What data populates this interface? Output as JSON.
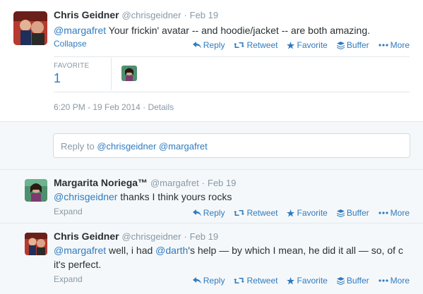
{
  "main_tweet": {
    "name": "Chris Geidner",
    "handle": "@chrisgeidner",
    "sep": "·",
    "date": "Feb 19",
    "mention": "@margafret",
    "text": " Your frickin' avatar -- and hoodie/jacket -- are both amazing.",
    "collapse": "Collapse",
    "stats_label": "FAVORITE",
    "stats_count": "1",
    "timestamp": "6:20 PM - 19 Feb 2014",
    "timestamp_sep": "·",
    "details": "Details"
  },
  "actions": {
    "reply": "Reply",
    "retweet": "Retweet",
    "favorite": "Favorite",
    "buffer": "Buffer",
    "more": "More"
  },
  "reply_box": {
    "placeholder_prefix": "Reply to ",
    "placeholder_mentions": "@chrisgeidner @margafret"
  },
  "replies": [
    {
      "name": "Margarita Noriega™",
      "handle": "@margafret",
      "sep": "·",
      "date": "Feb 19",
      "mention": "@chrisgeidner",
      "text": " thanks I think yours rocks",
      "text2": "",
      "expand": "Expand"
    },
    {
      "name": "Chris Geidner",
      "handle": "@chrisgeidner",
      "sep": "·",
      "date": "Feb 19",
      "mention": "@margafret",
      "text": " well, i had ",
      "mention2": "@darth",
      "text_after": "'s help — by which I mean, he did it all — so, of c",
      "text2": "it's perfect.",
      "expand": "Expand"
    }
  ],
  "colors": {
    "link": "#2f7bbf",
    "muted": "#8899a6",
    "border": "#e1e8ed",
    "panel": "#f5f8fa"
  }
}
